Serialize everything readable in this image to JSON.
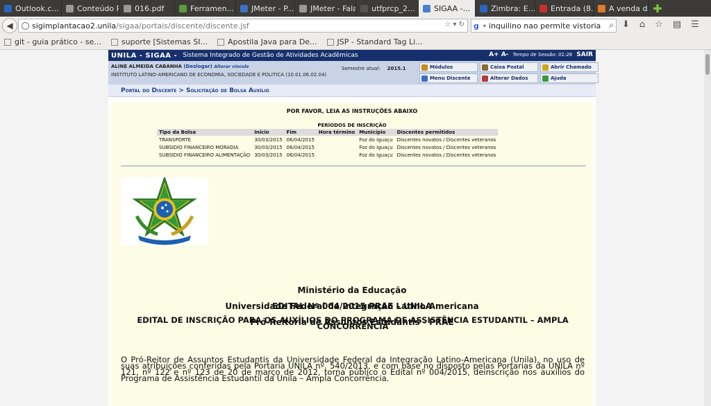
{
  "browser": {
    "tabs": [
      {
        "label": "Outlook.c...",
        "icon_color": "#2a66c2"
      },
      {
        "label": "Conteúdo Pr...",
        "icon_color": "#999999"
      },
      {
        "label": "016.pdf",
        "icon_color": "#999999"
      },
      {
        "label": "Ferramen...",
        "icon_color": "#5b9a3a"
      },
      {
        "label": "JMeter - P...",
        "icon_color": "#3d6fc4"
      },
      {
        "label": "JMeter - Fala...",
        "icon_color": "#999999"
      },
      {
        "label": "utfprcp_2...",
        "icon_color": "#555555"
      },
      {
        "label": "SIGAA -...",
        "icon_color": "#4a7fd0",
        "active": true
      },
      {
        "label": "Zimbra: E...",
        "icon_color": "#2a66c2"
      },
      {
        "label": "Entrada (8...",
        "icon_color": "#c9302c"
      },
      {
        "label": "A venda d...",
        "icon_color": "#e0792a"
      }
    ],
    "url_host": "sigimplantacao2.unila",
    "url_path": "/sigaa/portais/discente/discente.jsf",
    "search_value": "inquilino nao permite vistoria",
    "bookmarks": [
      "git - guia prático - se...",
      "suporte [Sistemas SI...",
      "Apostila Java para De...",
      "JSP - Standard Tag Li..."
    ]
  },
  "sigaa": {
    "brand": "UNILA - SIGAA -",
    "subtitle": "Sistema Integrado de Gestão de Atividades Acadêmicas",
    "font_controls": "A+ A-",
    "session_label": "Tempo de Sessão: 01:26",
    "logout_label": "SAIR",
    "user_name": "ALINE ALMEIDA CABANHA",
    "logout_link": "(Deslogar)",
    "alter_link": "Alterar vínculo",
    "institute": "INSTITUTO LATINO-AMERICANO DE ECONOMIA, SOCIEDADE E POLÍTICA (10.01.06.02.04)",
    "semester_label": "Semestre atual:",
    "semester_value": "2015.1",
    "menu": [
      {
        "label": "Módulos",
        "icon_color": "#c98a1e"
      },
      {
        "label": "Caixa Postal",
        "icon_color": "#8a6a3a"
      },
      {
        "label": "Abrir Chamado",
        "icon_color": "#d4a51a"
      },
      {
        "label": "Menu Discente",
        "icon_color": "#3d6fc4"
      },
      {
        "label": "Alterar Dados",
        "icon_color": "#b23a3a"
      },
      {
        "label": "Ajuda",
        "icon_color": "#3a9a3a"
      }
    ],
    "breadcrumb": "Portal do Discente > Solicitação de Bolsa Auxílio"
  },
  "content": {
    "notice": "POR FAVOR, LEIA AS INSTRUÇÕES ABAIXO",
    "periods_title": "PERÍODOS DE INSCRIÇÃO",
    "table_headers": [
      "Tipo da Bolsa",
      "Início",
      "Fim",
      "Hora término",
      "Município",
      "Discentes permitidos"
    ],
    "table_rows": [
      [
        "TRANSPORTE",
        "30/03/2015",
        "06/04/2015",
        "",
        "Foz do Iguaçu",
        "Discentes novatos / Discentes veteranos"
      ],
      [
        "SUBSIDIO FINANCEIRO MORADIA",
        "30/03/2015",
        "06/04/2015",
        "",
        "Foz do Iguaçu",
        "Discentes novatos / Discentes veteranos"
      ],
      [
        "SUBSIDIO FINANCEIRO ALIMENTAÇÃO",
        "30/03/2015",
        "06/04/2015",
        "",
        "Foz do Iguaçu",
        "Discentes novatos / Discentes veteranos"
      ]
    ],
    "ministry": "Ministério da Educação",
    "university": "Universidade Federal da Integração Latino-Americana",
    "prae": "Pró-Reitoria de Assuntos Estudantis - PRAE",
    "edital_title": "EDITAL Nº 004/2015 PRAE – UNILA",
    "edital_subtitle": "EDITAL DE INSCRIÇÃO PARA OS AUXÍLIOS DO PROGRAMA DE ASSISTÊNCIA ESTUDANTIL – AMPLA CONCORRÊNCIA",
    "paragraph": "O Pró-Reitor de Assuntos Estudantis da Universidade Federal da Integração Latino-Americana (Unila), no uso de suas atribuições conferidas pela Portaria UNILA nº. 540/2013, e com base no disposto pelas Portarias da UNILA nº 121, nº 122 e nº 123 de 20 de março de 2012, torna público o Edital nº 004/2015, deinscrição nos auxílios do Programa de Assistência Estudantil da Unila – Ampla Concorrência."
  }
}
